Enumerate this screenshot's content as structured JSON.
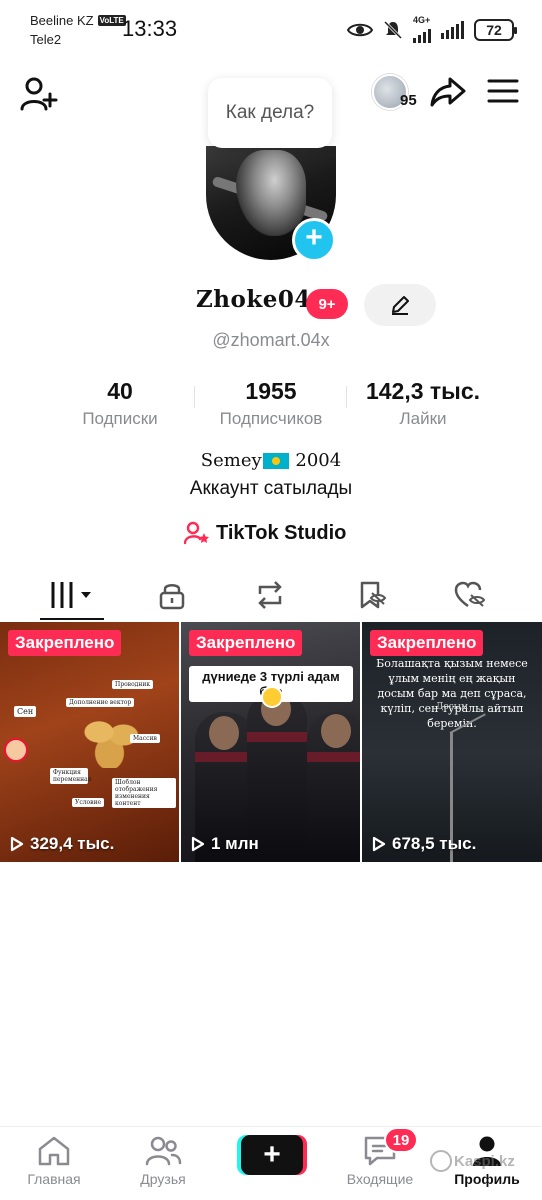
{
  "status_bar": {
    "carrier_primary": "Beeline KZ",
    "volte": "VoLTE",
    "carrier_secondary": "Tele2",
    "time": "13:33",
    "network": "4G+",
    "battery": "72"
  },
  "header": {
    "visitor_count": "95",
    "bubble_text": "Как дела?"
  },
  "profile": {
    "display_name": "Zhoke04",
    "notification_badge": "9+",
    "handle": "@zhomart.04x",
    "stats": [
      {
        "value": "40",
        "label": "Подписки"
      },
      {
        "value": "1955",
        "label": "Подписчиков"
      },
      {
        "value": "142,3 тыс.",
        "label": "Лайки"
      }
    ],
    "bio_line1_a": "Semey",
    "bio_line1_b": "2004",
    "bio_line2": "Аккаунт сатылады",
    "studio_link": "TikTok Studio"
  },
  "tabs": [
    {
      "icon": "grid-icon",
      "active": true
    },
    {
      "icon": "lock-icon",
      "active": false
    },
    {
      "icon": "repost-icon",
      "active": false
    },
    {
      "icon": "bookmark-hidden-icon",
      "active": false
    },
    {
      "icon": "heart-hidden-icon",
      "active": false
    }
  ],
  "videos": [
    {
      "pinned": "Закреплено",
      "views": "329,4 тыс.",
      "labels": [
        "Сен",
        "Проводник",
        "Дополнение вектор",
        "Функция переменная",
        "Массив",
        "Шоблон отображения изменения контент",
        "Условие"
      ]
    },
    {
      "pinned": "Закреплено",
      "views": "1 млн",
      "caption": "дүниеде 3 түрлі адам бар"
    },
    {
      "pinned": "Закреплено",
      "views": "678,5 тыс.",
      "caption": "Болашақта қызым немесе ұлым менің ең жақын досым бар ма деп сұраса, күліп, сен туралы айтып беремін.",
      "caption_sub": "Досым"
    }
  ],
  "bottom_nav": {
    "home": "Главная",
    "friends": "Друзья",
    "inbox": "Входящие",
    "inbox_badge": "19",
    "profile": "Профиль",
    "watermark": "Kaspi.kz"
  },
  "colors": {
    "accent_pink": "#fe2c55",
    "accent_cyan": "#20c4ee",
    "text_muted": "#8a8b91"
  }
}
